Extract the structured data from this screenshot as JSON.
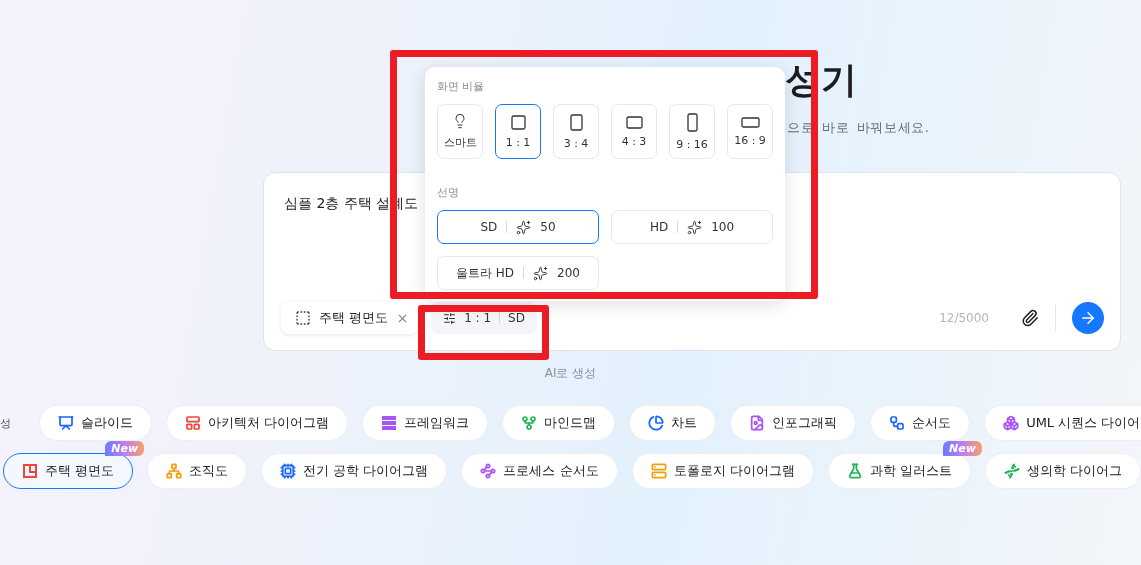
{
  "header": {
    "title": "성기",
    "subtitle": "으로 바로 바꿔보세요."
  },
  "prompt": {
    "value": "심플 2층 주택 설계도",
    "tag": {
      "label": "주택 평면도"
    },
    "settings": {
      "ratio": "1 : 1",
      "quality": "SD",
      "highlight": true
    },
    "counter": "12/5000"
  },
  "popover": {
    "highlight": true,
    "ratio_heading": "화면 비율",
    "ratios": [
      {
        "kind": "smart",
        "label": "스마트",
        "selected": false
      },
      {
        "kind": "ratio",
        "label": "1 : 1",
        "selected": true
      },
      {
        "kind": "ratio",
        "label": "3 : 4",
        "selected": false
      },
      {
        "kind": "ratio",
        "label": "4 : 3",
        "selected": false
      },
      {
        "kind": "ratio",
        "label": "9 : 16",
        "selected": false
      },
      {
        "kind": "ratio",
        "label": "16 : 9",
        "selected": false
      }
    ],
    "quality_heading": "선명",
    "qualities": [
      {
        "label": "SD",
        "cost": "50",
        "selected": true
      },
      {
        "label": "HD",
        "cost": "100",
        "selected": false
      },
      {
        "label": "울트라 HD",
        "cost": "200",
        "selected": false
      }
    ]
  },
  "caption": "AI로 생성",
  "category_label": "성",
  "chips": [
    [
      {
        "label": "슬라이드",
        "color": "#1a66ff",
        "selected": false
      },
      {
        "label": "아키텍처 다이어그램",
        "color": "#f04438",
        "selected": false
      },
      {
        "label": "프레임워크",
        "color": "#a855f7",
        "selected": false
      },
      {
        "label": "마인드맵",
        "color": "#22b45a",
        "selected": false
      },
      {
        "label": "차트",
        "color": "#1a66ff",
        "selected": false
      },
      {
        "label": "인포그래픽",
        "color": "#a855f7",
        "selected": false
      },
      {
        "label": "순서도",
        "color": "#1a66ff",
        "selected": false
      },
      {
        "label": "UML 시퀀스 다이어",
        "color": "#a855f7",
        "selected": false
      }
    ],
    [
      {
        "label": "주택 평면도",
        "color": "#f04438",
        "selected": true,
        "badge": "New"
      },
      {
        "label": "조직도",
        "color": "#f59e0b",
        "selected": false
      },
      {
        "label": "전기 공학 다이어그램",
        "color": "#1a66ff",
        "selected": false
      },
      {
        "label": "프로세스 순서도",
        "color": "#a855f7",
        "selected": false
      },
      {
        "label": "토폴로지 다이어그램",
        "color": "#f59e0b",
        "selected": false
      },
      {
        "label": "과학 일러스트",
        "color": "#22b45a",
        "selected": false,
        "badge": "New"
      },
      {
        "label": "생의학 다이어그",
        "color": "#22b45a",
        "selected": false
      }
    ]
  ]
}
